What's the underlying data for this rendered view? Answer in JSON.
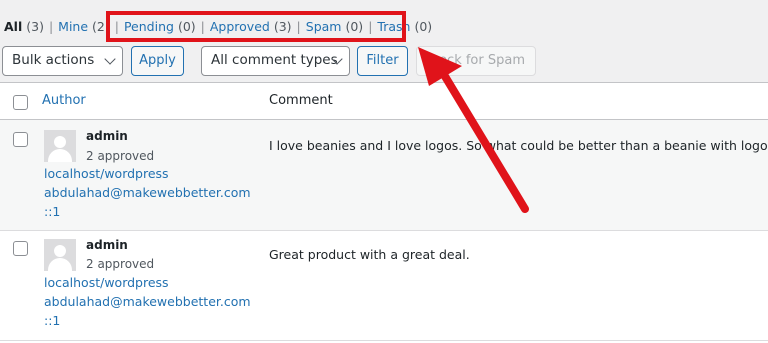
{
  "status_filters": {
    "all": {
      "label": "All",
      "count": "(3)"
    },
    "mine": {
      "label": "Mine",
      "count": "(2)"
    },
    "pending": {
      "label": "Pending",
      "count": "(0)"
    },
    "approved": {
      "label": "Approved",
      "count": "(3)"
    },
    "spam": {
      "label": "Spam",
      "count": "(0)"
    },
    "trash": {
      "label": "Trash",
      "count": "(0)"
    },
    "separator": "|"
  },
  "controls": {
    "bulk_actions": "Bulk actions",
    "apply": "Apply",
    "comment_types": "All comment types",
    "filter": "Filter",
    "check_spam": "Check for Spam"
  },
  "table": {
    "headers": {
      "author": "Author",
      "comment": "Comment"
    },
    "rows": [
      {
        "author_name": "admin",
        "approved": "2 approved",
        "url": "localhost/wordpress",
        "email": "abdulahad@makewebbetter.com",
        "ip": "::1",
        "comment": "I love beanies and I love logos. So what could be better than a beanie with logo?"
      },
      {
        "author_name": "admin",
        "approved": "2 approved",
        "url": "localhost/wordpress",
        "email": "abdulahad@makewebbetter.com",
        "ip": "::1",
        "comment": "Great product with a great deal."
      }
    ]
  },
  "annotation": {
    "color": "#e0131a"
  }
}
